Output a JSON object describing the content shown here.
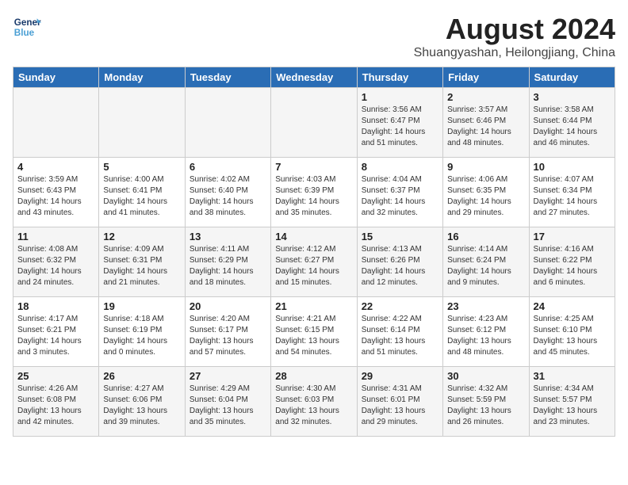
{
  "logo": {
    "line1": "General",
    "line2": "Blue"
  },
  "title": "August 2024",
  "location": "Shuangyashan, Heilongjiang, China",
  "weekdays": [
    "Sunday",
    "Monday",
    "Tuesday",
    "Wednesday",
    "Thursday",
    "Friday",
    "Saturday"
  ],
  "weeks": [
    [
      {
        "day": "",
        "info": ""
      },
      {
        "day": "",
        "info": ""
      },
      {
        "day": "",
        "info": ""
      },
      {
        "day": "",
        "info": ""
      },
      {
        "day": "1",
        "info": "Sunrise: 3:56 AM\nSunset: 6:47 PM\nDaylight: 14 hours\nand 51 minutes."
      },
      {
        "day": "2",
        "info": "Sunrise: 3:57 AM\nSunset: 6:46 PM\nDaylight: 14 hours\nand 48 minutes."
      },
      {
        "day": "3",
        "info": "Sunrise: 3:58 AM\nSunset: 6:44 PM\nDaylight: 14 hours\nand 46 minutes."
      }
    ],
    [
      {
        "day": "4",
        "info": "Sunrise: 3:59 AM\nSunset: 6:43 PM\nDaylight: 14 hours\nand 43 minutes."
      },
      {
        "day": "5",
        "info": "Sunrise: 4:00 AM\nSunset: 6:41 PM\nDaylight: 14 hours\nand 41 minutes."
      },
      {
        "day": "6",
        "info": "Sunrise: 4:02 AM\nSunset: 6:40 PM\nDaylight: 14 hours\nand 38 minutes."
      },
      {
        "day": "7",
        "info": "Sunrise: 4:03 AM\nSunset: 6:39 PM\nDaylight: 14 hours\nand 35 minutes."
      },
      {
        "day": "8",
        "info": "Sunrise: 4:04 AM\nSunset: 6:37 PM\nDaylight: 14 hours\nand 32 minutes."
      },
      {
        "day": "9",
        "info": "Sunrise: 4:06 AM\nSunset: 6:35 PM\nDaylight: 14 hours\nand 29 minutes."
      },
      {
        "day": "10",
        "info": "Sunrise: 4:07 AM\nSunset: 6:34 PM\nDaylight: 14 hours\nand 27 minutes."
      }
    ],
    [
      {
        "day": "11",
        "info": "Sunrise: 4:08 AM\nSunset: 6:32 PM\nDaylight: 14 hours\nand 24 minutes."
      },
      {
        "day": "12",
        "info": "Sunrise: 4:09 AM\nSunset: 6:31 PM\nDaylight: 14 hours\nand 21 minutes."
      },
      {
        "day": "13",
        "info": "Sunrise: 4:11 AM\nSunset: 6:29 PM\nDaylight: 14 hours\nand 18 minutes."
      },
      {
        "day": "14",
        "info": "Sunrise: 4:12 AM\nSunset: 6:27 PM\nDaylight: 14 hours\nand 15 minutes."
      },
      {
        "day": "15",
        "info": "Sunrise: 4:13 AM\nSunset: 6:26 PM\nDaylight: 14 hours\nand 12 minutes."
      },
      {
        "day": "16",
        "info": "Sunrise: 4:14 AM\nSunset: 6:24 PM\nDaylight: 14 hours\nand 9 minutes."
      },
      {
        "day": "17",
        "info": "Sunrise: 4:16 AM\nSunset: 6:22 PM\nDaylight: 14 hours\nand 6 minutes."
      }
    ],
    [
      {
        "day": "18",
        "info": "Sunrise: 4:17 AM\nSunset: 6:21 PM\nDaylight: 14 hours\nand 3 minutes."
      },
      {
        "day": "19",
        "info": "Sunrise: 4:18 AM\nSunset: 6:19 PM\nDaylight: 14 hours\nand 0 minutes."
      },
      {
        "day": "20",
        "info": "Sunrise: 4:20 AM\nSunset: 6:17 PM\nDaylight: 13 hours\nand 57 minutes."
      },
      {
        "day": "21",
        "info": "Sunrise: 4:21 AM\nSunset: 6:15 PM\nDaylight: 13 hours\nand 54 minutes."
      },
      {
        "day": "22",
        "info": "Sunrise: 4:22 AM\nSunset: 6:14 PM\nDaylight: 13 hours\nand 51 minutes."
      },
      {
        "day": "23",
        "info": "Sunrise: 4:23 AM\nSunset: 6:12 PM\nDaylight: 13 hours\nand 48 minutes."
      },
      {
        "day": "24",
        "info": "Sunrise: 4:25 AM\nSunset: 6:10 PM\nDaylight: 13 hours\nand 45 minutes."
      }
    ],
    [
      {
        "day": "25",
        "info": "Sunrise: 4:26 AM\nSunset: 6:08 PM\nDaylight: 13 hours\nand 42 minutes."
      },
      {
        "day": "26",
        "info": "Sunrise: 4:27 AM\nSunset: 6:06 PM\nDaylight: 13 hours\nand 39 minutes."
      },
      {
        "day": "27",
        "info": "Sunrise: 4:29 AM\nSunset: 6:04 PM\nDaylight: 13 hours\nand 35 minutes."
      },
      {
        "day": "28",
        "info": "Sunrise: 4:30 AM\nSunset: 6:03 PM\nDaylight: 13 hours\nand 32 minutes."
      },
      {
        "day": "29",
        "info": "Sunrise: 4:31 AM\nSunset: 6:01 PM\nDaylight: 13 hours\nand 29 minutes."
      },
      {
        "day": "30",
        "info": "Sunrise: 4:32 AM\nSunset: 5:59 PM\nDaylight: 13 hours\nand 26 minutes."
      },
      {
        "day": "31",
        "info": "Sunrise: 4:34 AM\nSunset: 5:57 PM\nDaylight: 13 hours\nand 23 minutes."
      }
    ]
  ]
}
